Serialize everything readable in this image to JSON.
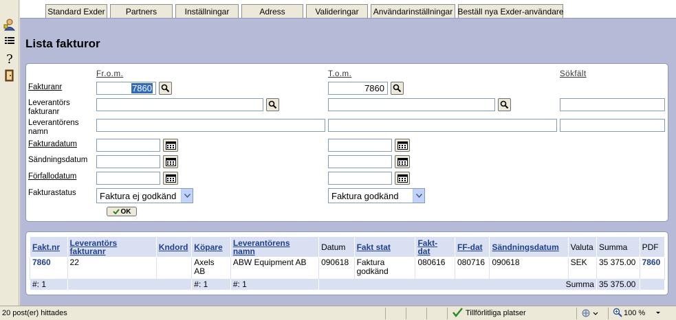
{
  "tabs": [
    {
      "label": "Standard Exder"
    },
    {
      "label": "Partners"
    },
    {
      "label": "Inställningar"
    },
    {
      "label": "Adress"
    },
    {
      "label": "Valideringar"
    },
    {
      "label": "Användarinställningar"
    },
    {
      "label": "Beställ nya Exder-användare"
    }
  ],
  "page_title": "Lista fakturor",
  "search": {
    "from_header": "Fr.o.m.",
    "to_header": "T.o.m.",
    "search_header": "Sökfält",
    "fakturanr_label": "Fakturanr",
    "fakturanr_from": "7860",
    "fakturanr_to": "7860",
    "leverantors_fakturanr_label_1": "Leverantörs",
    "leverantors_fakturanr_label_2": "fakturanr",
    "leverantorens_namn_label_1": "Leverantörens",
    "leverantorens_namn_label_2": "namn",
    "fakturadatum_label": "Fakturadatum",
    "sandningsdatum_label": "Sändningsdatum",
    "forfallodatum_label": "Förfallodatum",
    "fakturastatus_label": "Fakturastatus",
    "status_from": "Faktura ej godkänd",
    "status_to": "Faktura godkänd",
    "ok_label": "OK"
  },
  "table": {
    "headers": {
      "fakt_nr": "Fakt.nr",
      "lev_fakturanr_1": "Leverantörs",
      "lev_fakturanr_2": "fakturanr",
      "kndord": "Kndord",
      "kopare": "Köpare",
      "lev_namn_1": "Leverantörens",
      "lev_namn_2": "namn",
      "datum": "Datum",
      "fakt_stat": "Fakt stat",
      "fakt_dat_1": "Fakt-",
      "fakt_dat_2": "dat",
      "ff_dat": "FF-dat",
      "sandningsdatum": "Sändningsdatum",
      "valuta": "Valuta",
      "summa": "Summa",
      "pdf": "PDF"
    },
    "rows": [
      {
        "fakt_nr": "7860",
        "lev_fakturanr": "22",
        "kndord": "",
        "kopare_1": "Axels",
        "kopare_2": "AB",
        "lev_namn": "ABW Equipment AB",
        "datum": "090618",
        "fakt_stat_1": "Faktura",
        "fakt_stat_2": "godkänd",
        "fakt_dat": "080616",
        "ff_dat": "080716",
        "sandningsdatum": "090618",
        "valuta": "SEK",
        "summa": "35 375.00",
        "pdf": "7860"
      }
    ],
    "footer": {
      "count_1": "#: 1",
      "count_2": "#: 1",
      "count_3": "#: 1",
      "summa_label": "Summa",
      "summa_value": "35 375.00"
    }
  },
  "statusbar": {
    "left_text": "20 post(er) hittades",
    "zone_text": "Tillförlitliga platser",
    "zoom_text": "100 %"
  },
  "colors": {
    "main_background": "#b5bbd6",
    "header_cell": "#d9e0f2",
    "link": "#1f3f8f"
  }
}
